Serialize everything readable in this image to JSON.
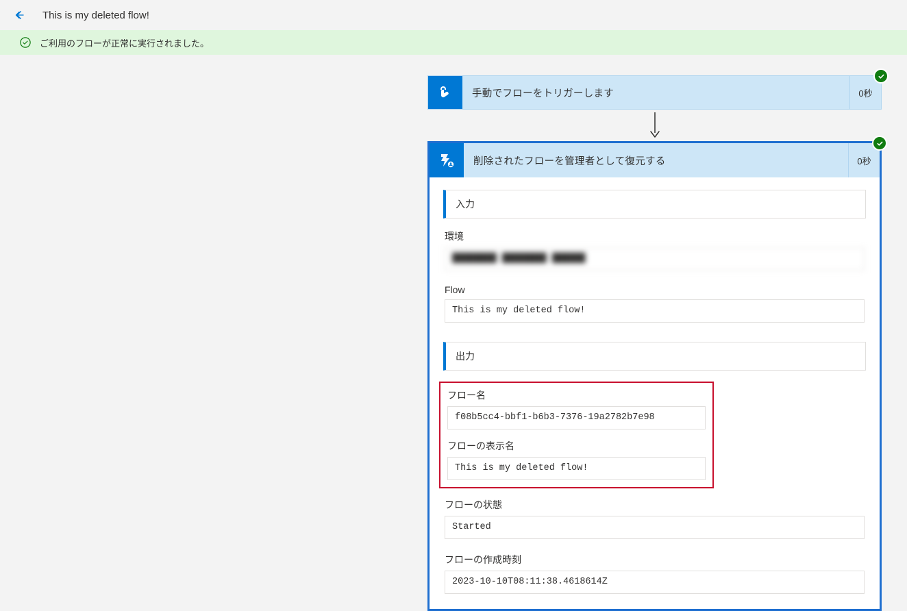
{
  "header": {
    "title": "This is my deleted flow!"
  },
  "banner": {
    "message": "ご利用のフローが正常に実行されました。"
  },
  "trigger": {
    "title": "手動でフローをトリガーします",
    "duration": "0秒"
  },
  "action": {
    "title": "削除されたフローを管理者として復元する",
    "duration": "0秒",
    "input_section_label": "入力",
    "output_section_label": "出力",
    "inputs": {
      "environment": {
        "label": "環境",
        "value": "████████ ████████ ██████"
      },
      "flow": {
        "label": "Flow",
        "value": "This is my deleted flow!"
      }
    },
    "outputs": {
      "flow_name": {
        "label": "フロー名",
        "value": "f08b5cc4-bbf1-b6b3-7376-19a2782b7e98"
      },
      "flow_display_name": {
        "label": "フローの表示名",
        "value": "This is my deleted flow!"
      },
      "flow_state": {
        "label": "フローの状態",
        "value": "Started"
      },
      "flow_created": {
        "label": "フローの作成時刻",
        "value": "2023-10-10T08:11:38.4618614Z"
      }
    }
  }
}
